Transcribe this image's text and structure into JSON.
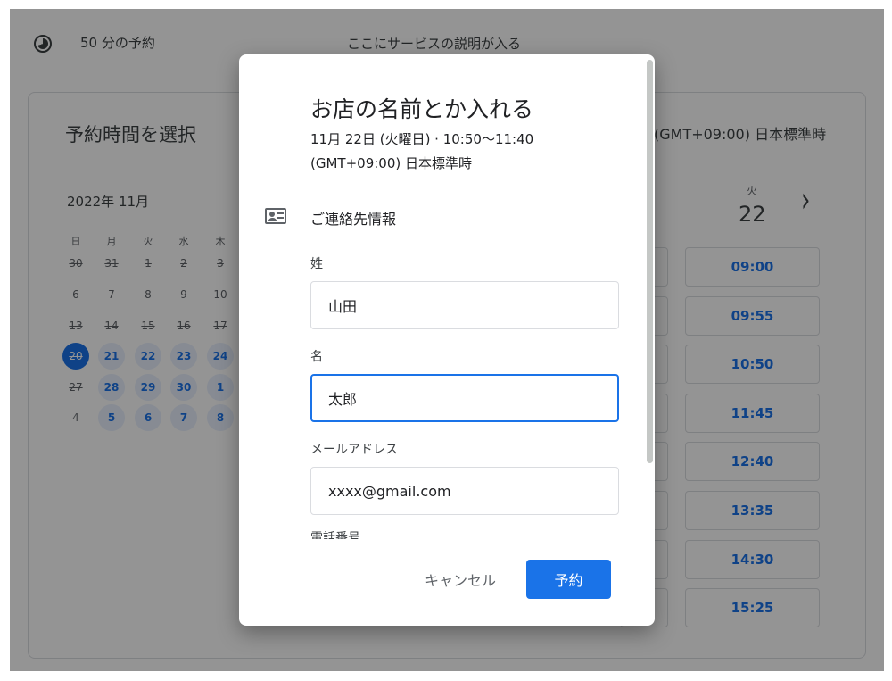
{
  "background": {
    "duration": "50 分の予約",
    "service_description": "ここにサービスの説明が入る",
    "select_time_title": "予約時間を選択",
    "timezone": "(GMT+09:00) 日本標準時",
    "calendar": {
      "month": "2022年 11月",
      "weekdays": [
        "日",
        "月",
        "火",
        "水",
        "木"
      ],
      "rows": [
        [
          "30",
          "31",
          "1",
          "2",
          "3"
        ],
        [
          "6",
          "7",
          "8",
          "9",
          "10"
        ],
        [
          "13",
          "14",
          "15",
          "16",
          "17"
        ],
        [
          "20",
          "21",
          "22",
          "23",
          "24"
        ],
        [
          "27",
          "28",
          "29",
          "30",
          "1"
        ],
        [
          "4",
          "5",
          "6",
          "7",
          "8"
        ]
      ]
    },
    "day_column": {
      "weekday": "火",
      "date": "22"
    },
    "next_arrow": "›",
    "slots": [
      "09:00",
      "09:55",
      "10:50",
      "11:45",
      "12:40",
      "13:35",
      "14:30",
      "15:25"
    ]
  },
  "dialog": {
    "title": "お店の名前とか入れる",
    "datetime": "11月 22日 (火曜日) · 10:50〜11:40",
    "timezone": "(GMT+09:00) 日本標準時",
    "section_title": "ご連絡先情報",
    "last_name_label": "姓",
    "last_name_value": "山田",
    "first_name_label": "名",
    "first_name_value": "太郎",
    "email_label": "メールアドレス",
    "email_value": "xxxx@gmail.com",
    "phone_label": "電話番号",
    "cancel_label": "キャンセル",
    "book_label": "予約"
  },
  "colors": {
    "accent": "#1a73e8",
    "scrim": "rgba(0,0,0,0.42)"
  }
}
